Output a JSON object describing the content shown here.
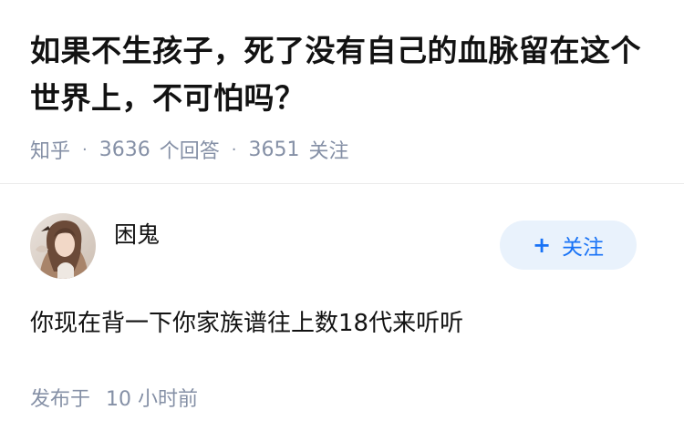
{
  "question": {
    "title": "如果不生孩子，死了没有自己的血脉留在这个世界上，不可怕吗？",
    "source": "知乎",
    "separator": "·",
    "answer_count": "3636",
    "answer_label": "个回答",
    "follower_count": "3651",
    "follower_label": "关注"
  },
  "answer": {
    "author": {
      "name": "困鬼",
      "avatar_icon": "avatar-photo"
    },
    "follow_button": {
      "icon": "plus-icon",
      "label": "关注"
    },
    "content": "你现在背一下你家族谱往上数18代来听听",
    "published_label": "发布于",
    "published_time": "10 小时前"
  },
  "colors": {
    "text": "#121212",
    "meta": "#8590a6",
    "accent": "#1772f6",
    "button_bg": "#e9f2fc",
    "divider": "#ebebeb"
  }
}
